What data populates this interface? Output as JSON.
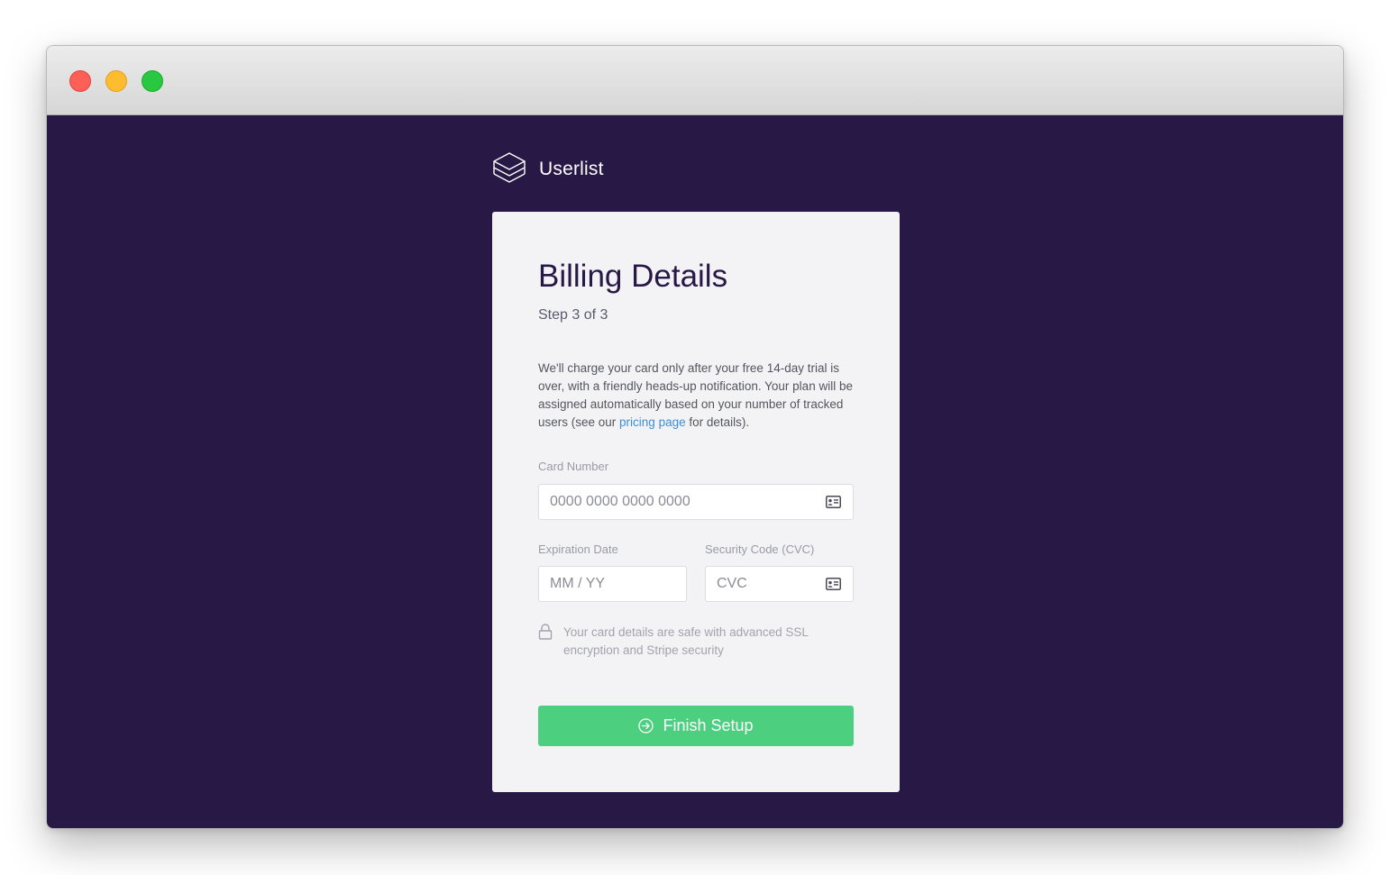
{
  "brand": {
    "name": "Userlist",
    "icon": "layers-logo-icon"
  },
  "billing": {
    "title": "Billing Details",
    "step": "Step 3 of 3",
    "description_before_link": "We'll charge your card only after your free 14-day trial is over, with a friendly heads-up notification. Your plan will be assigned automatically based on your number of tracked users (see our ",
    "description_link": "pricing page",
    "description_after_link": " for details).",
    "card_number": {
      "label": "Card Number",
      "placeholder": "0000 0000 0000 0000",
      "value": "",
      "icon": "credit-card-icon"
    },
    "expiration": {
      "label": "Expiration Date",
      "placeholder": "MM / YY",
      "value": ""
    },
    "cvc": {
      "label": "Security Code (CVC)",
      "placeholder": "CVC",
      "value": "",
      "icon": "credit-card-icon"
    },
    "security_note": "Your card details are safe with advanced SSL encryption and Stripe security",
    "security_icon": "lock-icon",
    "finish_label": "Finish Setup",
    "finish_icon": "arrow-circle-right-icon"
  },
  "colors": {
    "background": "#281846",
    "card": "#f3f3f6",
    "title": "#281846",
    "link": "#3b8fdb",
    "button": "#4ccf7f"
  }
}
